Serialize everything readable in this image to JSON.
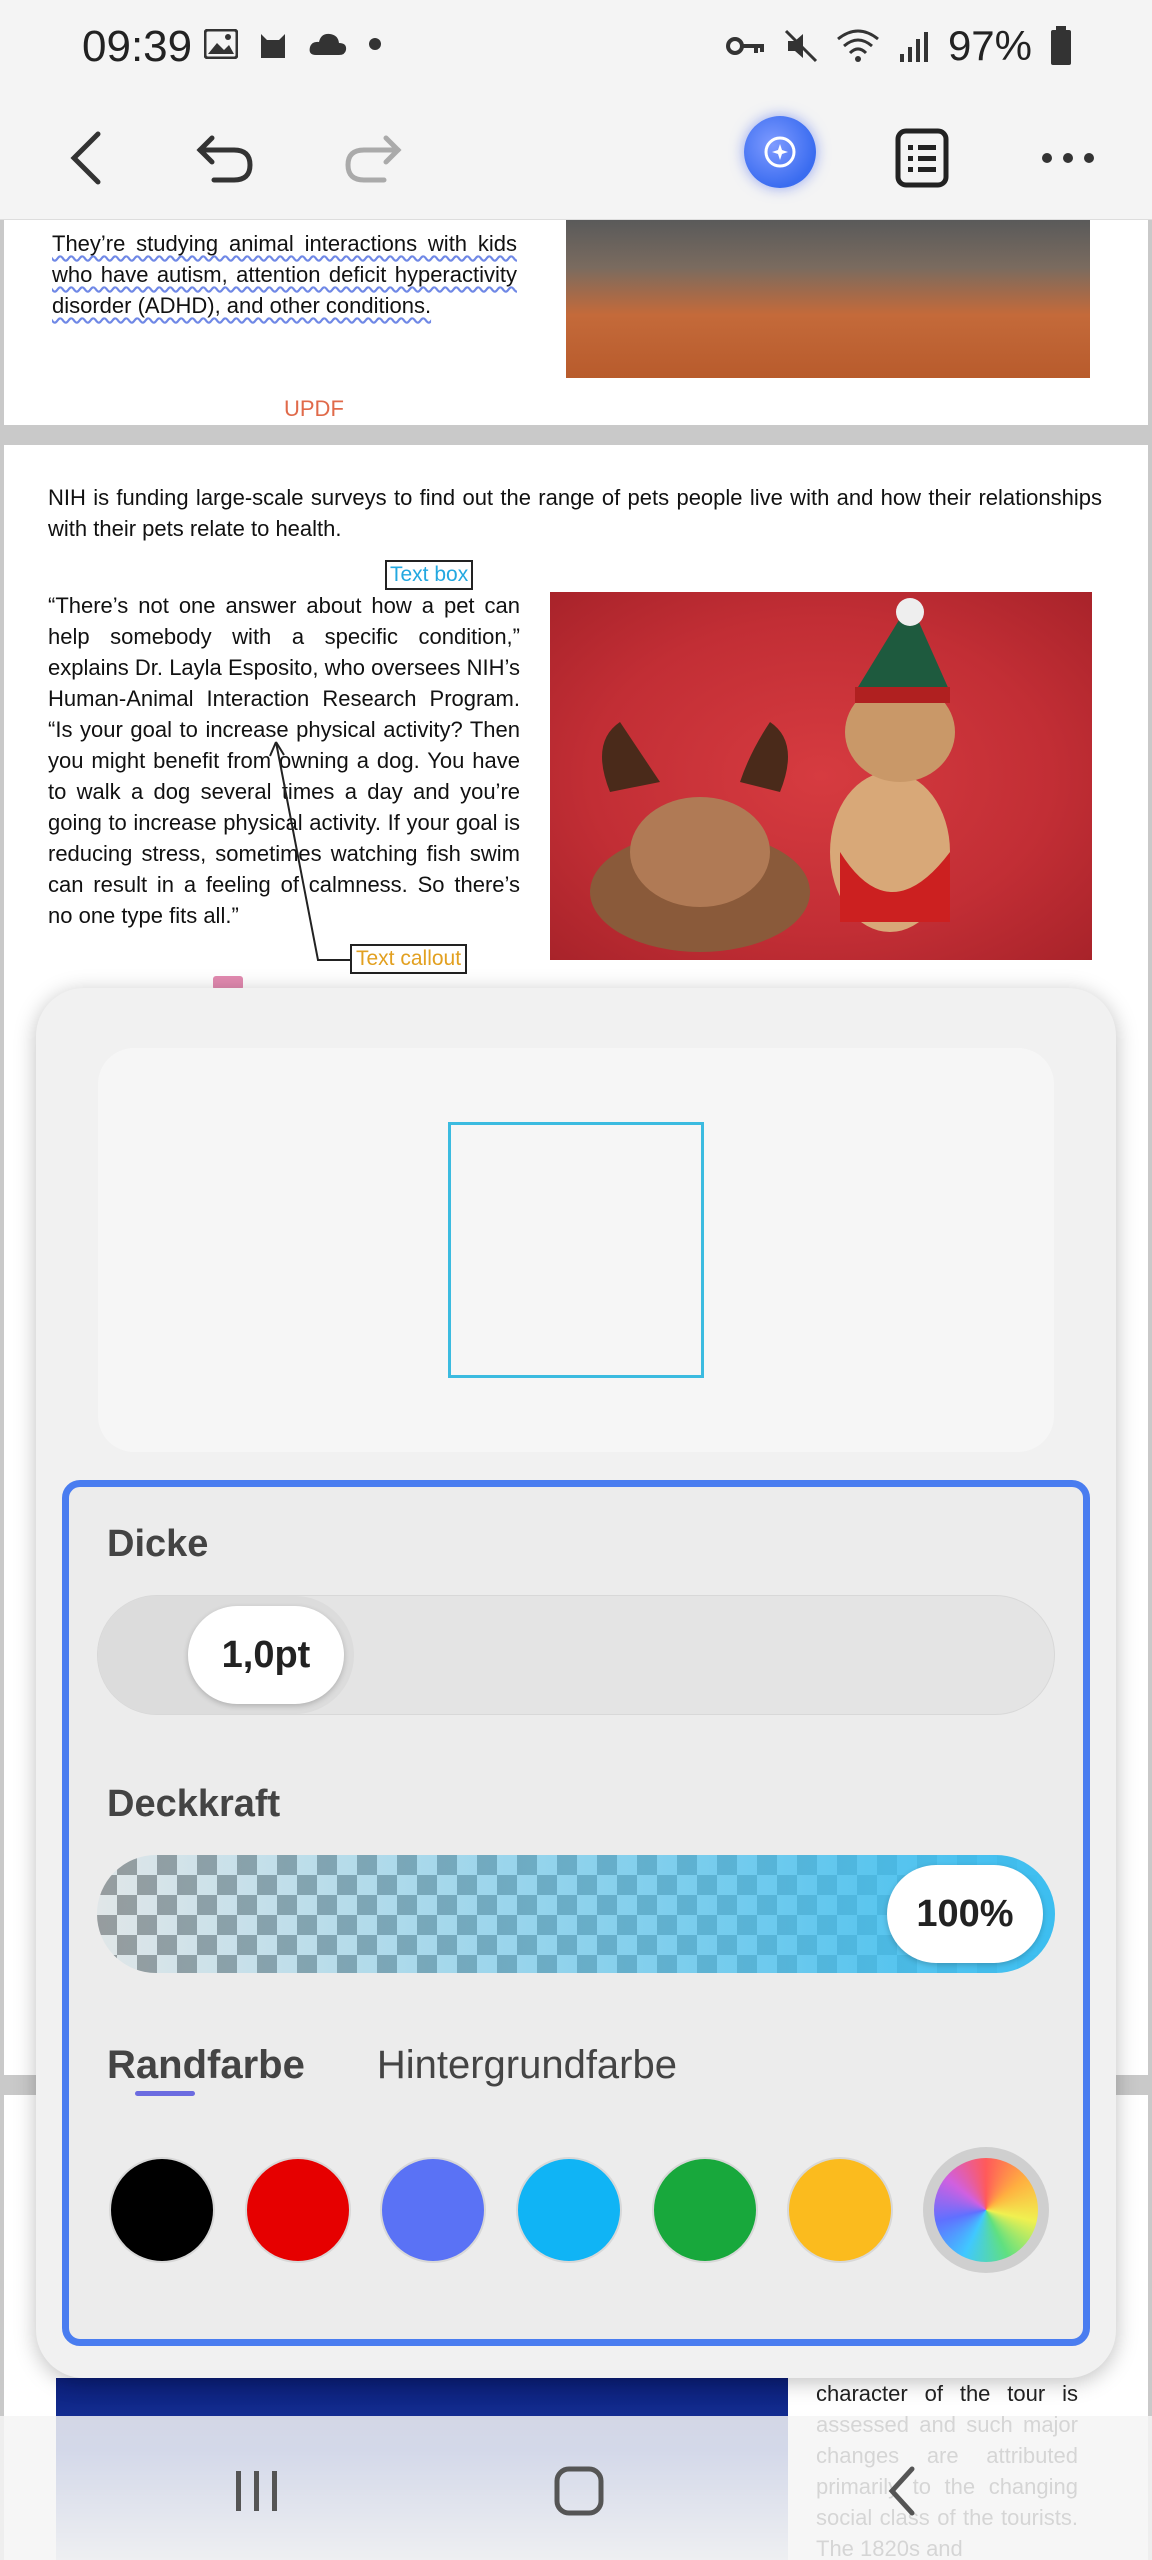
{
  "status_bar": {
    "time": "09:39",
    "battery": "97%",
    "icons_left": [
      "gallery-icon",
      "cat-icon",
      "cloud-icon",
      "dot-icon"
    ],
    "icons_right": [
      "key-icon",
      "mute-icon",
      "wifi-icon",
      "signal-icon",
      "battery-icon"
    ]
  },
  "toolbar": {
    "buttons": [
      "back-icon",
      "undo-icon",
      "redo-icon",
      "ai-assistant-icon",
      "outline-icon",
      "more-icon"
    ]
  },
  "document": {
    "page1_text": [
      "They’re studying animal interactions with kids who have autism, attention deficit hyperactivity disorder (ADHD), and other conditions."
    ],
    "watermark": "UPDF",
    "page2_para1": "NIH is funding large-scale surveys to find out the range of pets people live with and how their relationships with their pets relate to health.",
    "text_box_label": "Text box",
    "page2_para2": "“There’s not one answer about how a pet can help somebody with a specific condition,” explains Dr. Layla Esposito, who oversees NIH’s Human-Animal Interaction Research Program. “Is your goal to increase physical activity? Then you might benefit from owning a dog. You have to walk a dog several times a day and you’re going to increase physical activity. If your goal is reducing stress, sometimes watching fish swim can result in a feeling of calmness. So there’s no one type fits all.”",
    "callout_label": "Text callout",
    "page3_text": "character of the tour is assessed and such major changes are attributed primarily to the changing social class of the tourists. The 1820s and"
  },
  "panel": {
    "thickness_label": "Dicke",
    "thickness_value": "1,0pt",
    "thickness_fraction": 0.1,
    "opacity_label": "Deckkraft",
    "opacity_value": "100%",
    "opacity_fraction": 1.0,
    "tabs": [
      "Randfarbe",
      "Hintergrundfarbe"
    ],
    "active_tab": "Randfarbe",
    "colors": [
      "#000000",
      "#e60000",
      "#5a72f5",
      "#10b4f5",
      "#18a83c",
      "#fbbb1e"
    ],
    "preview_stroke_color": "#3bbbe0"
  },
  "navbar": {
    "buttons": [
      "recents-icon",
      "home-icon",
      "back-nav-icon"
    ]
  }
}
